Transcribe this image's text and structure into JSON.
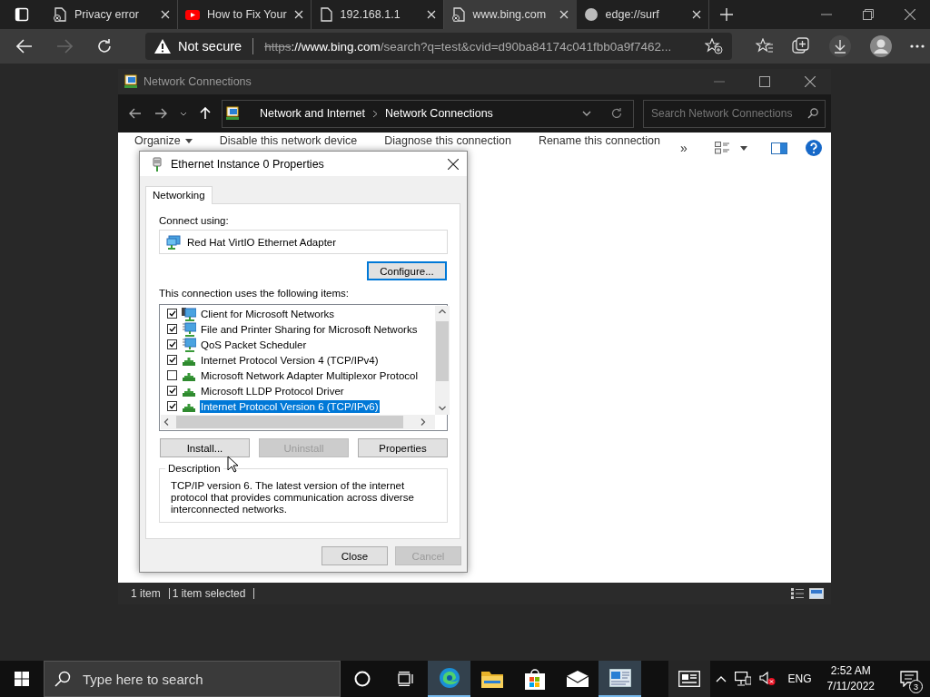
{
  "browser": {
    "tabs": [
      {
        "title": "Privacy error",
        "kind": "warning",
        "selected": false
      },
      {
        "title": "How to Fix Your",
        "kind": "video",
        "selected": false
      },
      {
        "title": "192.168.1.1",
        "kind": "document",
        "selected": false
      },
      {
        "title": "www.bing.com",
        "kind": "warning",
        "selected": true
      },
      {
        "title": "edge://surf",
        "kind": "blank",
        "selected": false
      }
    ],
    "security": "Not secure",
    "url_scheme": "https",
    "url_host": "://www.bing.com",
    "url_path": "/search?q=test&cvid=d90ba84174c041fbb0a9f7462..."
  },
  "explorer": {
    "title": "Network Connections",
    "breadcrumb": [
      "Network and Internet",
      "Network Connections"
    ],
    "search": {
      "placeholder": "Search Network Connections"
    },
    "commands": [
      {
        "label": "Organize",
        "dropdown": true
      },
      {
        "label": "Disable this network device",
        "dropdown": false
      },
      {
        "label": "Diagnose this connection",
        "dropdown": false
      },
      {
        "label": "Rename this connection",
        "dropdown": false
      }
    ],
    "more": "»",
    "status": [
      "1 item",
      "1 item selected"
    ]
  },
  "dialog": {
    "title": "Ethernet Instance 0 Properties",
    "tabs": [
      {
        "label": "Networking",
        "selected": true
      }
    ],
    "connect_label": "Connect using:",
    "adapter": "Red Hat VirtIO Ethernet Adapter",
    "configure": "Configure...",
    "items_label": "This connection uses the following items:",
    "items": [
      {
        "label": "Client for Microsoft Networks",
        "kind": "client",
        "checked": true,
        "selected": false
      },
      {
        "label": "File and Printer Sharing for Microsoft Networks",
        "kind": "service",
        "checked": true,
        "selected": false
      },
      {
        "label": "QoS Packet Scheduler",
        "kind": "service",
        "checked": true,
        "selected": false
      },
      {
        "label": "Internet Protocol Version 4 (TCP/IPv4)",
        "kind": "protocol",
        "checked": true,
        "selected": false
      },
      {
        "label": "Microsoft Network Adapter Multiplexor Protocol",
        "kind": "protocol",
        "checked": false,
        "selected": false
      },
      {
        "label": "Microsoft LLDP Protocol Driver",
        "kind": "protocol",
        "checked": true,
        "selected": false
      },
      {
        "label": "Internet Protocol Version 6 (TCP/IPv6)",
        "kind": "protocol",
        "checked": true,
        "selected": true
      }
    ],
    "item_buttons": [
      {
        "label": "Install...",
        "disabled": false
      },
      {
        "label": "Uninstall",
        "disabled": true
      },
      {
        "label": "Properties",
        "disabled": false
      }
    ],
    "description_label": "Description",
    "description": "TCP/IP version 6. The latest version of the internet protocol that provides communication across diverse interconnected networks.",
    "footer_buttons": [
      {
        "label": "Close",
        "disabled": false
      },
      {
        "label": "Cancel",
        "disabled": true
      }
    ]
  },
  "taskbar": {
    "search": {
      "placeholder": "Type here to search"
    },
    "apps": [
      {
        "kind": "edge",
        "active": true
      },
      {
        "kind": "folder",
        "active": false
      },
      {
        "kind": "store",
        "active": false
      },
      {
        "kind": "mail",
        "active": false
      },
      {
        "kind": "network",
        "active": true
      }
    ],
    "language": "ENG",
    "time": "2:52 AM",
    "date": "7/11/2022",
    "notifications": "3"
  }
}
